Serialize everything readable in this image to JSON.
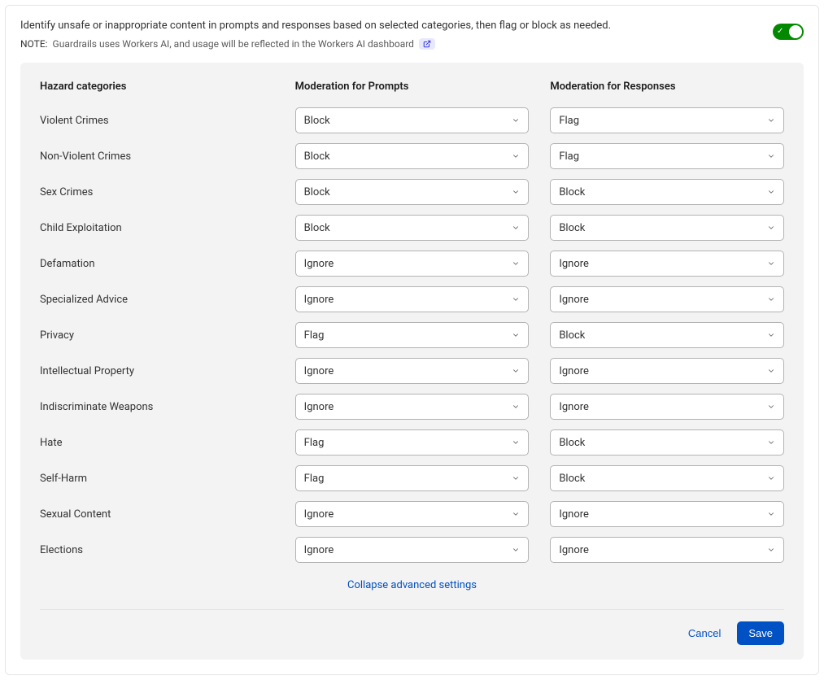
{
  "header": {
    "description": "Identify unsafe or inappropriate content in prompts and responses based on selected categories, then flag or block as needed.",
    "note_label": "NOTE:",
    "note_text": "Guardrails uses Workers AI, and usage will be reflected in the Workers AI dashboard",
    "toggle_on": true
  },
  "columns": {
    "hazard": "Hazard categories",
    "prompts": "Moderation for Prompts",
    "responses": "Moderation for Responses"
  },
  "rows": [
    {
      "label": "Violent Crimes",
      "prompt": "Block",
      "response": "Flag"
    },
    {
      "label": "Non-Violent Crimes",
      "prompt": "Block",
      "response": "Flag"
    },
    {
      "label": "Sex Crimes",
      "prompt": "Block",
      "response": "Block"
    },
    {
      "label": "Child Exploitation",
      "prompt": "Block",
      "response": "Block"
    },
    {
      "label": "Defamation",
      "prompt": "Ignore",
      "response": "Ignore"
    },
    {
      "label": "Specialized Advice",
      "prompt": "Ignore",
      "response": "Ignore"
    },
    {
      "label": "Privacy",
      "prompt": "Flag",
      "response": "Block"
    },
    {
      "label": "Intellectual Property",
      "prompt": "Ignore",
      "response": "Ignore"
    },
    {
      "label": "Indiscriminate Weapons",
      "prompt": "Ignore",
      "response": "Ignore"
    },
    {
      "label": "Hate",
      "prompt": "Flag",
      "response": "Block"
    },
    {
      "label": "Self-Harm",
      "prompt": "Flag",
      "response": "Block"
    },
    {
      "label": "Sexual Content",
      "prompt": "Ignore",
      "response": "Ignore"
    },
    {
      "label": "Elections",
      "prompt": "Ignore",
      "response": "Ignore"
    }
  ],
  "collapse_label": "Collapse advanced settings",
  "footer": {
    "cancel": "Cancel",
    "save": "Save"
  }
}
